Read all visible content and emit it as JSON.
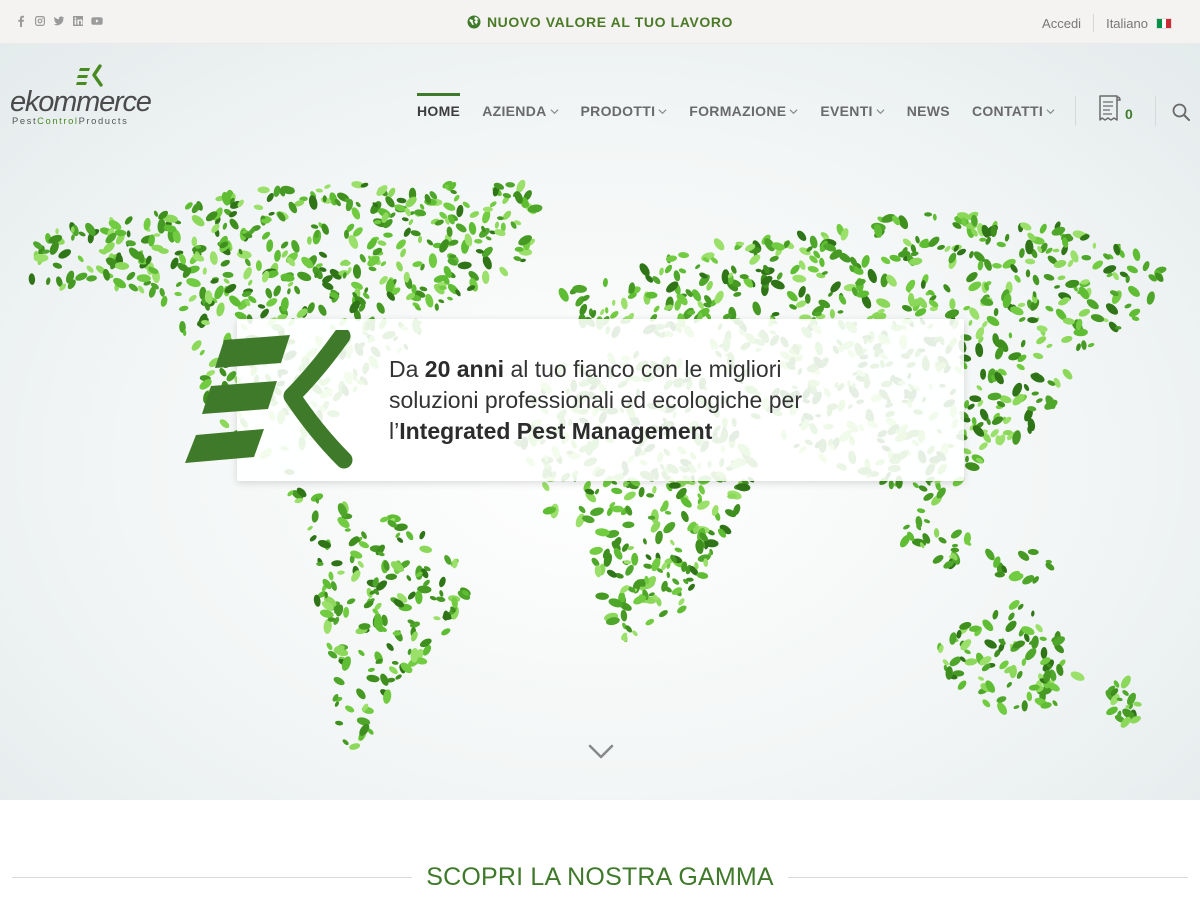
{
  "topbar": {
    "social": [
      "facebook-icon",
      "instagram-icon",
      "twitter-icon",
      "linkedin-icon",
      "youtube-icon"
    ],
    "tagline": "NUOVO VALORE AL TUO LAVORO",
    "login": "Accedi",
    "language": "Italiano"
  },
  "logo": {
    "word": "ekommerce",
    "sub_1": "Pest",
    "sub_2": "Control",
    "sub_3": "Products"
  },
  "nav": {
    "items": [
      {
        "label": "HOME",
        "active": true,
        "dropdown": false
      },
      {
        "label": "AZIENDA",
        "active": false,
        "dropdown": true
      },
      {
        "label": "PRODOTTI",
        "active": false,
        "dropdown": true
      },
      {
        "label": "FORMAZIONE",
        "active": false,
        "dropdown": true
      },
      {
        "label": "EVENTI",
        "active": false,
        "dropdown": true
      },
      {
        "label": "NEWS",
        "active": false,
        "dropdown": false
      },
      {
        "label": "CONTATTI",
        "active": false,
        "dropdown": true
      }
    ],
    "cart_count": "0"
  },
  "hero": {
    "line1_a": "Da ",
    "line1_b": "20 anni",
    "line1_c": " al tuo fianco con le migliori",
    "line2": "soluzioni professionali ed ecologiche per",
    "line3_a": "l’",
    "line3_b": "Integrated Pest Management"
  },
  "section": {
    "title": "SCOPRI LA NOSTRA GAMMA"
  },
  "colors": {
    "brand_green": "#3f7a2a",
    "logo_green": "#4a8a22",
    "nav_text": "#6a6a6a"
  }
}
